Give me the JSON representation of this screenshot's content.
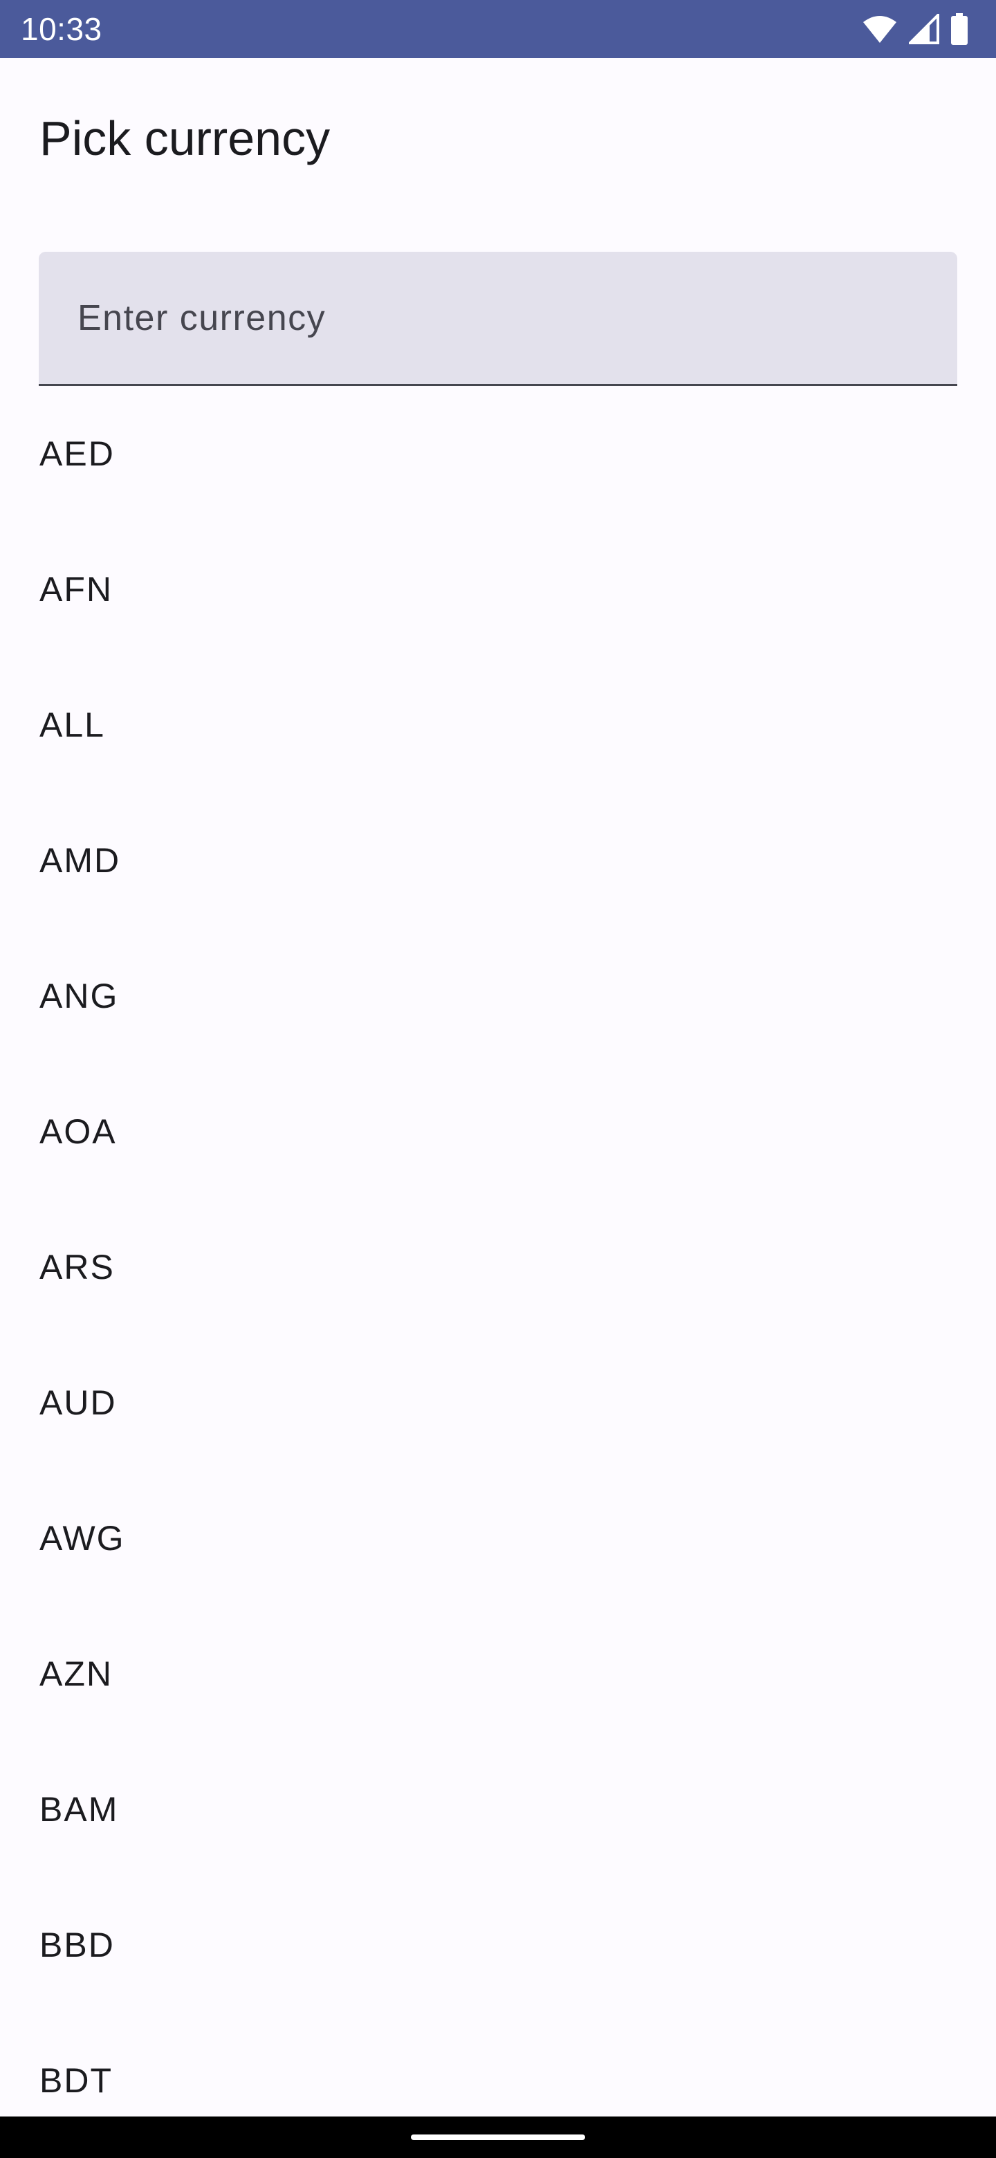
{
  "status_bar": {
    "time": "10:33",
    "icons": [
      "wifi-icon",
      "cellular-signal-icon",
      "battery-icon"
    ],
    "background": "#4b5a9b"
  },
  "header": {
    "title": "Pick currency"
  },
  "search": {
    "value": "",
    "placeholder": "Enter currency"
  },
  "currencies": [
    "AED",
    "AFN",
    "ALL",
    "AMD",
    "ANG",
    "AOA",
    "ARS",
    "AUD",
    "AWG",
    "AZN",
    "BAM",
    "BBD",
    "BDT"
  ],
  "colors": {
    "background": "#fdfbff",
    "field_fill": "#e3e1ec",
    "text": "#1b1b1f"
  }
}
